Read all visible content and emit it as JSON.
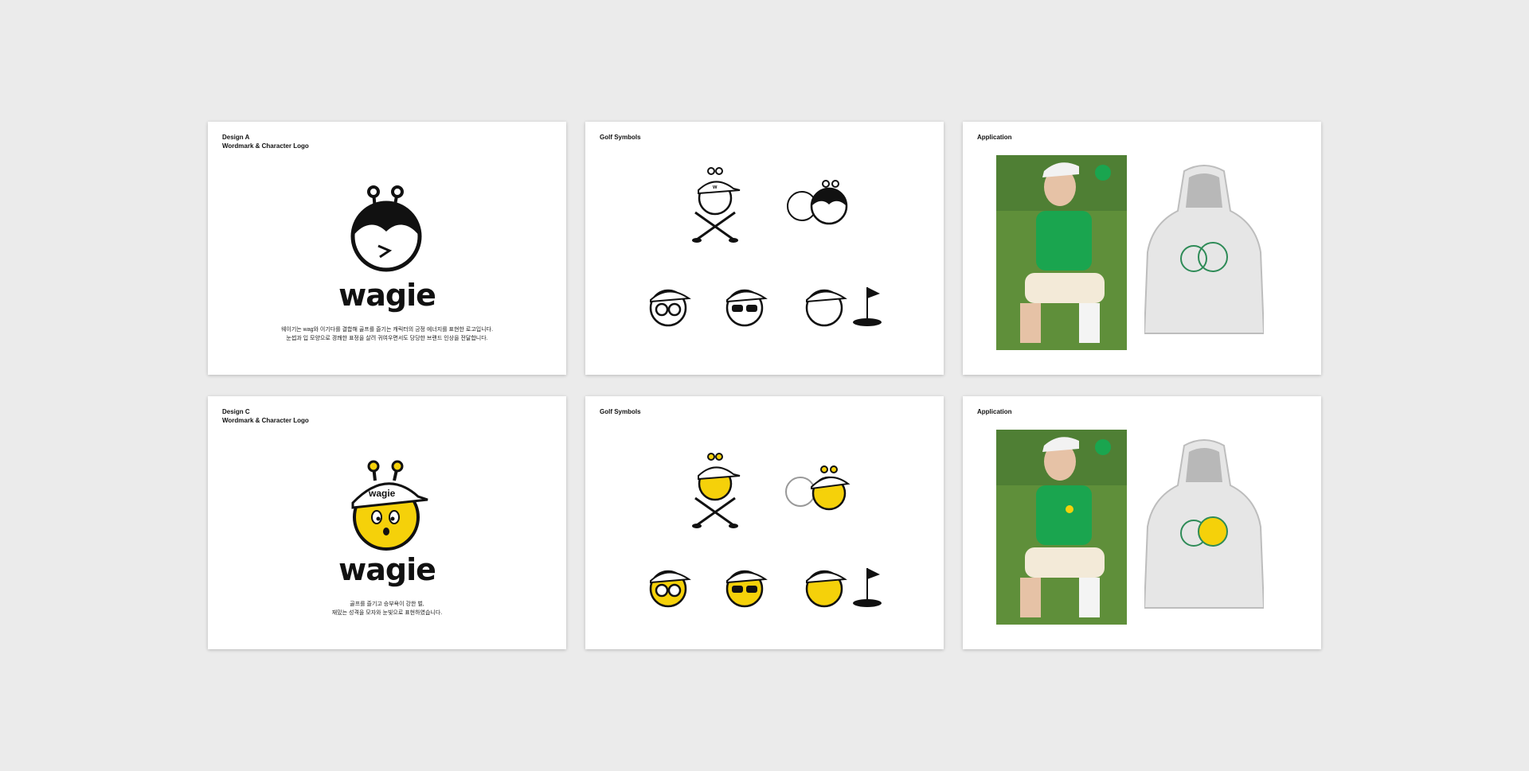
{
  "colors": {
    "background": "#ebebeb",
    "card": "#ffffff",
    "ink": "#111111",
    "yellow": "#f5d10a",
    "green": "#1aa54f",
    "grass": "#5f8f3a"
  },
  "cards": [
    {
      "label_line1": "Design A",
      "label_line2": "Wordmark & Character Logo",
      "wordmark": "wagie",
      "desc_line1": "웨이기는 wag와 이기다를 결합해 골프를 즐기는 캐릭터의 긍정 에너지를 표현한 로고입니다.",
      "desc_line2": "눈썹과 입 모양으로 경쾌한 표정을 살려 귀여우면서도 당당한 브랜드 인상을 전달합니다."
    },
    {
      "label_line1": "Golf Symbols"
    },
    {
      "label_line1": "Application"
    },
    {
      "label_line1": "Design C",
      "label_line2": "Wordmark & Character Logo",
      "wordmark": "wagie",
      "desc_line1": "골프를 즐기고 승부욕이 강한 벌,",
      "desc_line2": "재밌는 성격을 모자와 눈빛으로 표현하였습니다."
    },
    {
      "label_line1": "Golf Symbols"
    },
    {
      "label_line1": "Application"
    }
  ],
  "icons": {
    "character": "bee-character-icon",
    "crossed_clubs": "crossed-golf-clubs-icon",
    "golf_ball": "golf-ball-icon",
    "flag": "golf-flag-icon",
    "hoodie": "hoodie-icon",
    "photo": "golfer-photo"
  }
}
